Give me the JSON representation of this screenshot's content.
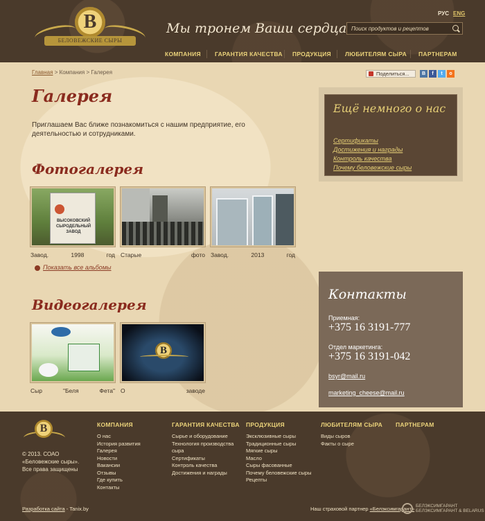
{
  "header": {
    "logo_letter": "B",
    "logo_ribbon": "БЕЛОВЕЖСКИЕ СЫРЫ",
    "slogan": "Мы тронем Ваши сердца...",
    "lang_ru": "РУС",
    "lang_en": "ENG",
    "search_placeholder": "Поиск продуктов и рецептов",
    "nav": [
      "КОМПАНИЯ",
      "ГАРАНТИЯ КАЧЕСТВА",
      "ПРОДУКЦИЯ",
      "ЛЮБИТЕЛЯМ СЫРА",
      "ПАРТНЕРАМ"
    ]
  },
  "breadcrumb": {
    "home": "Главная",
    "sep": ">",
    "company": "Компания",
    "current": "Галерея"
  },
  "page_title": "Галерея",
  "intro": "Приглашаем Вас ближе познакомиться с нашим предприятие, его деятельностью и сотрудниками.",
  "photo_gallery": {
    "title": "Фотогалерея",
    "items": [
      {
        "caption_parts": [
          "Завод.",
          "1998",
          "год"
        ],
        "sign_lines": [
          "ВЫСОКОВСКИЙ",
          "СЫРОДЕЛЬНЫЙ",
          "ЗАВОД"
        ]
      },
      {
        "caption_parts": [
          "Старые",
          "фото"
        ]
      },
      {
        "caption_parts": [
          "Завод.",
          "2013",
          "год"
        ]
      }
    ],
    "show_all": "Показать все альбомы"
  },
  "video_gallery": {
    "title": "Видеогалерея",
    "items": [
      {
        "caption_parts": [
          "Сыр",
          "\"Беля",
          "Фета\""
        ]
      },
      {
        "caption_parts": [
          "О",
          "заводе"
        ],
        "overlay_letter": "B"
      }
    ]
  },
  "share": {
    "label": "Поделиться...",
    "socials": [
      "В",
      "f",
      "t",
      "о"
    ],
    "colors": [
      "#4c75a3",
      "#3b5998",
      "#55acee",
      "#f4731c"
    ]
  },
  "more": {
    "title": "Ещё немного о нас",
    "links": [
      "Сертификаты",
      "Достижения и награды",
      "Контроль качества",
      "Почему беловежские сыры"
    ]
  },
  "contacts": {
    "title": "Контакты",
    "reception_label": "Приемная:",
    "reception_phone": "+375 16 3191-777",
    "marketing_label": "Отдел маркетинга:",
    "marketing_phone": "+375 16 3191-042",
    "email1": "bsyr@mail.ru",
    "email2": "marketing_cheese@mail.ru"
  },
  "footer": {
    "logo_letter": "B",
    "copyright": [
      "© 2013. СОАО",
      "«Беловежские сыры».",
      "Все права защищены"
    ],
    "columns": [
      {
        "title": "КОМПАНИЯ",
        "links": [
          "О нас",
          "История развития",
          "Галерея",
          "Новости",
          "Вакансии",
          "Отзывы",
          "Где купить",
          "Контакты"
        ]
      },
      {
        "title": "ГАРАНТИЯ КАЧЕСТВА",
        "links": [
          "Сырье и оборудование",
          "Технология производства",
          "сыра",
          "Сертификаты",
          "Контроль качества",
          "Достижения и награды"
        ]
      },
      {
        "title": "ПРОДУКЦИЯ",
        "links": [
          "Эксклюзивные сыры",
          "Традиционные сыры",
          "Мягкие сыры",
          "Масло",
          "Сыры фасованные",
          "Почему беловежские сыры",
          "Рецепты"
        ]
      },
      {
        "title": "ЛЮБИТЕЛЯМ СЫРА",
        "links": [
          "Виды сыров",
          "Факты о сыре"
        ]
      },
      {
        "title": "ПАРТНЕРАМ",
        "links": []
      }
    ],
    "dev_link": "Разработка сайта",
    "dev_sep": " - ",
    "dev_name": "Tanix.by",
    "partner_text": "Наш страховой партнер ",
    "partner_link": "«Белэксимгарант»",
    "partner_logo_line1": "БЕЛЭКСИМГАРАНТ",
    "partner_logo_line2": "БЕЛЭКСИМГАРАНТ & BELARUS"
  }
}
